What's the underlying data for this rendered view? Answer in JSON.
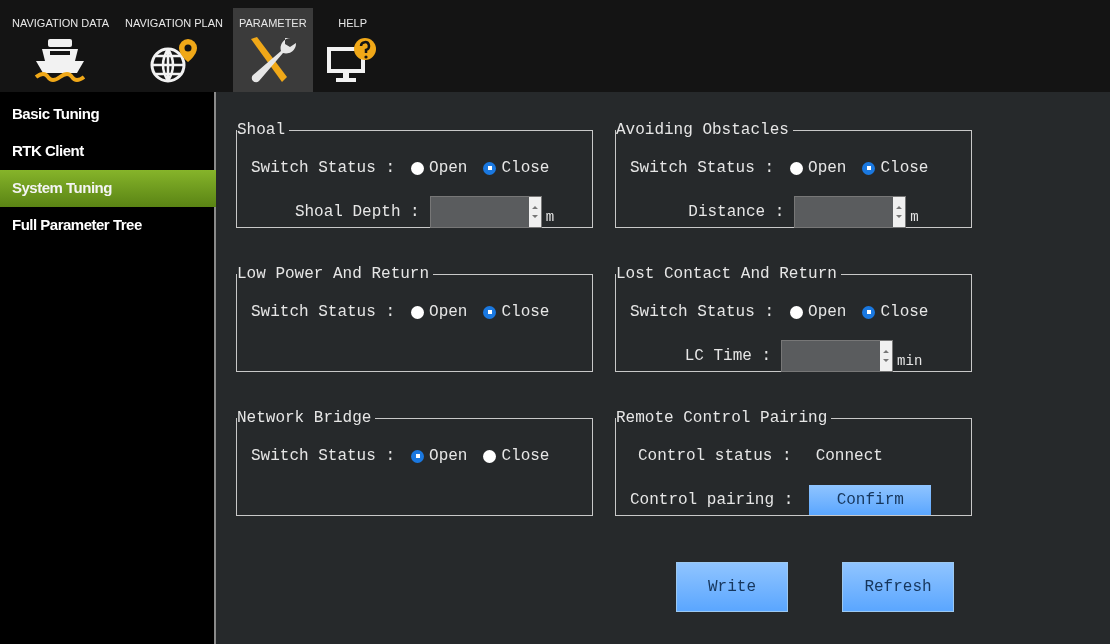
{
  "menu": [
    {
      "label": "NAVIGATION DATA",
      "kind": "ship",
      "selected": false
    },
    {
      "label": "NAVIGATION PLAN",
      "kind": "globe",
      "selected": false
    },
    {
      "label": "PARAMETER",
      "kind": "tools",
      "selected": true
    },
    {
      "label": "HELP",
      "kind": "help",
      "selected": false
    }
  ],
  "sidebar": {
    "items": [
      {
        "label": "Basic Tuning",
        "selected": false
      },
      {
        "label": "RTK Client",
        "selected": false
      },
      {
        "label": "System Tuning",
        "selected": true
      },
      {
        "label": "Full Parameter Tree",
        "selected": false
      }
    ]
  },
  "groups": [
    {
      "title": "Shoal",
      "rows": [
        {
          "kind": "switch",
          "label": "Switch Status :",
          "options": [
            {
              "label": "Open",
              "selected": false
            },
            {
              "label": "Close",
              "selected": true
            }
          ]
        },
        {
          "kind": "spin",
          "label": "Shoal Depth :",
          "unit": "m"
        }
      ]
    },
    {
      "title": "Avoiding Obstacles",
      "rows": [
        {
          "kind": "switch",
          "label": "Switch Status :",
          "options": [
            {
              "label": "Open",
              "selected": false
            },
            {
              "label": "Close",
              "selected": true
            }
          ]
        },
        {
          "kind": "spin",
          "label": "Distance :",
          "unit": "m"
        }
      ]
    },
    {
      "title": "Low Power And Return",
      "rows": [
        {
          "kind": "switch",
          "label": "Switch Status :",
          "options": [
            {
              "label": "Open",
              "selected": false
            },
            {
              "label": "Close",
              "selected": true
            }
          ]
        }
      ]
    },
    {
      "title": "Lost Contact And Return",
      "rows": [
        {
          "kind": "switch",
          "label": "Switch Status :",
          "options": [
            {
              "label": "Open",
              "selected": false
            },
            {
              "label": "Close",
              "selected": true
            }
          ]
        },
        {
          "kind": "spin",
          "label": "LC Time :",
          "unit": "min"
        }
      ]
    },
    {
      "title": "Network Bridge",
      "rows": [
        {
          "kind": "switch",
          "label": "Switch Status :",
          "options": [
            {
              "label": "Open",
              "selected": true
            },
            {
              "label": "Close",
              "selected": false
            }
          ]
        }
      ]
    },
    {
      "title": "Remote Control Pairing",
      "rows": [
        {
          "kind": "text",
          "label": "Control status :",
          "value": "Connect"
        },
        {
          "kind": "button",
          "label": "Control pairing :",
          "button": "Confirm"
        }
      ]
    }
  ],
  "buttons": [
    "Write",
    "Refresh"
  ]
}
